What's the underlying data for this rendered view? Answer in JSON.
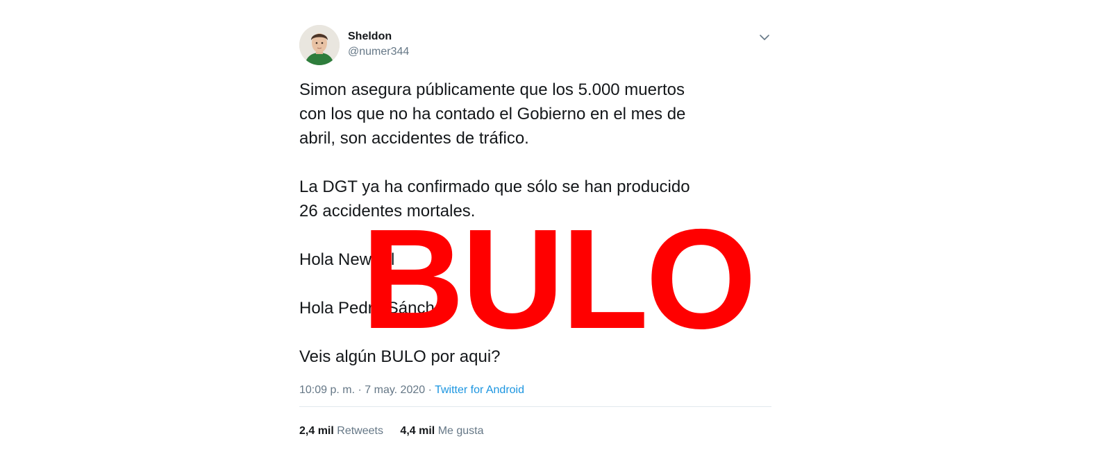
{
  "tweet": {
    "author_name": "Sheldon",
    "author_handle": "@numer344",
    "paragraphs": [
      "Simon asegura públicamente que los 5.000 muertos\ncon los que no ha contado el Gobierno en el mes de\nabril, son accidentes de tráfico.",
      "La DGT ya ha confirmado que sólo se han producido\n26 accidentes mortales.",
      "Hola Newtral",
      "Hola Pedro Sánchez",
      "Veis algún BULO por aqui?"
    ],
    "time": "10:09 p. m. · 7 may. 2020 · ",
    "source": "Twitter for Android",
    "retweets_count": "2,4 mil",
    "retweets_label": "Retweets",
    "likes_count": "4,4 mil",
    "likes_label": "Me gusta"
  },
  "stamp": {
    "text": "BULO",
    "color": "#ff0000"
  },
  "icons": {
    "caret": "chevron-down-icon",
    "avatar": "avatar"
  },
  "colors": {
    "text": "#14171a",
    "secondary": "#657786",
    "link": "#1b95e0",
    "divider": "#e1e8ed"
  }
}
